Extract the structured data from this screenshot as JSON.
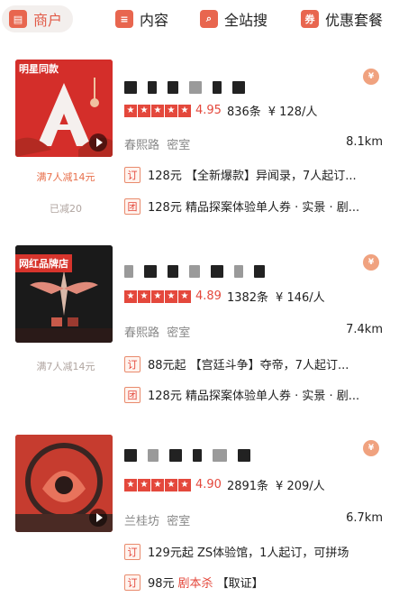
{
  "tabs": [
    {
      "label": "商户",
      "icon": "store-icon",
      "color": "#e8664f",
      "active": true
    },
    {
      "label": "内容",
      "icon": "chat-icon",
      "color": "#e8664f",
      "active": false
    },
    {
      "label": "全站搜",
      "icon": "search-doc-icon",
      "color": "#e8664f",
      "active": false
    },
    {
      "label": "优惠套餐",
      "icon": "coupon-icon",
      "color": "#e8664f",
      "active": false
    }
  ],
  "colors": {
    "accent": "#e4483c",
    "promo": "#e8704c"
  },
  "cards": [
    {
      "badge": "明星同款",
      "rating": "4.95",
      "reviews": "836条",
      "price": "¥ 128/人",
      "street": "春熙路",
      "category": "密室",
      "distance": "8.1km",
      "promos": [
        "满7人减14元",
        "已减20"
      ],
      "deals": [
        {
          "tag": "订",
          "text": "128元 【全新爆款】异闻录，7人起订..."
        },
        {
          "tag": "团",
          "text": "128元 精品探案体验单人券 · 实景 · 剧..."
        }
      ]
    },
    {
      "badge": "网红品牌店",
      "rating": "4.89",
      "reviews": "1382条",
      "price": "¥ 146/人",
      "street": "春熙路",
      "category": "密室",
      "distance": "7.4km",
      "promos": [
        "满7人减14元"
      ],
      "deals": [
        {
          "tag": "订",
          "text": "88元起 【宫廷斗争】夺帝，7人起订..."
        },
        {
          "tag": "团",
          "text": "128元 精品探案体验单人券 · 实景 · 剧..."
        }
      ]
    },
    {
      "badge": "",
      "rating": "4.90",
      "reviews": "2891条",
      "price": "¥ 209/人",
      "street": "兰桂坊",
      "category": "密室",
      "distance": "6.7km",
      "promos": [],
      "deals": [
        {
          "tag": "订",
          "text": "129元起 ZS体验馆，1人起订，可拼场"
        },
        {
          "tag": "订",
          "text": "98元",
          "hl": "剧本杀",
          "rest": "【取证】"
        }
      ]
    }
  ]
}
